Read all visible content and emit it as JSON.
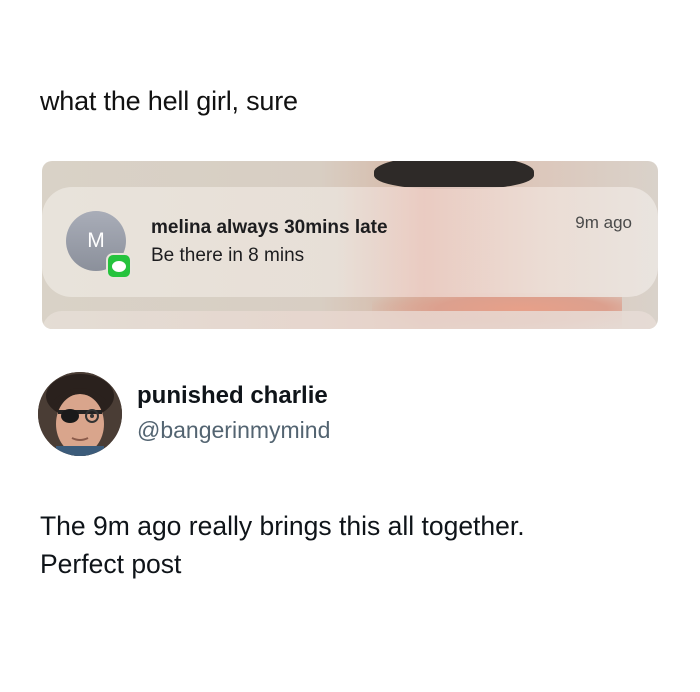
{
  "caption": "what the hell girl, sure",
  "notification": {
    "avatar_initial": "M",
    "sender": "melina always 30mins late",
    "message": "Be there in 8 mins",
    "time": "9m ago",
    "app_icon": "messages-icon"
  },
  "tweet": {
    "display_name": "punished charlie",
    "handle": "@bangerinmymind",
    "text_lines": [
      "The 9m ago really brings this all together.",
      "Perfect post"
    ]
  }
}
